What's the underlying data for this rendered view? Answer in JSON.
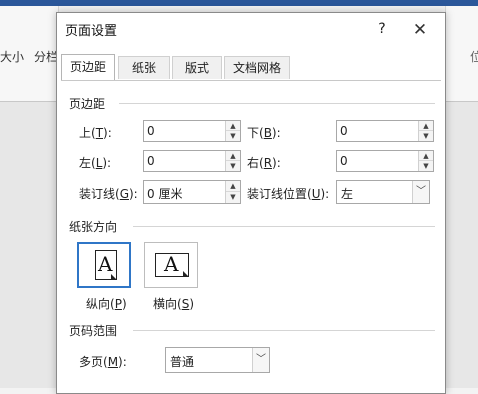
{
  "background": {
    "left_label_1": "大小",
    "left_label_2": "分栏",
    "right_label": "位"
  },
  "dialog": {
    "title": "页面设置",
    "help_icon": "?",
    "close_icon": "✕",
    "tabs": [
      {
        "label": "页边距",
        "active": true
      },
      {
        "label": "纸张",
        "active": false
      },
      {
        "label": "版式",
        "active": false
      },
      {
        "label": "文档网格",
        "active": false
      }
    ],
    "margins": {
      "section_title": "页边距",
      "top_label": "上(",
      "top_key": "T",
      "top_label_end": "):",
      "top_value": "0",
      "bottom_label": "下(",
      "bottom_key": "B",
      "bottom_label_end": "):",
      "bottom_value": "0",
      "left_label": "左(",
      "left_key": "L",
      "left_label_end": "):",
      "left_value": "0",
      "right_label": "右(",
      "right_key": "R",
      "right_label_end": "):",
      "right_value": "0",
      "gutter_label": "装订线(",
      "gutter_key": "G",
      "gutter_label_end": "):",
      "gutter_value": "0 厘米",
      "gutter_pos_label": "装订线位置(",
      "gutter_pos_key": "U",
      "gutter_pos_label_end": "):",
      "gutter_pos_value": "左"
    },
    "orientation": {
      "section_title": "纸张方向",
      "portrait_label": "纵向(",
      "portrait_key": "P",
      "portrait_label_end": ")",
      "landscape_label": "横向(",
      "landscape_key": "S",
      "landscape_label_end": ")",
      "icon_letter": "A",
      "selected": "portrait"
    },
    "pages": {
      "section_title": "页码范围",
      "multi_label": "多页(",
      "multi_key": "M",
      "multi_label_end": "):",
      "multi_value": "普通"
    },
    "arrow_up": "▲",
    "arrow_down": "▼",
    "combo_arrow": "﹀"
  },
  "colors": {
    "accent": "#2f76c7",
    "title_bar": "#2b579a"
  }
}
